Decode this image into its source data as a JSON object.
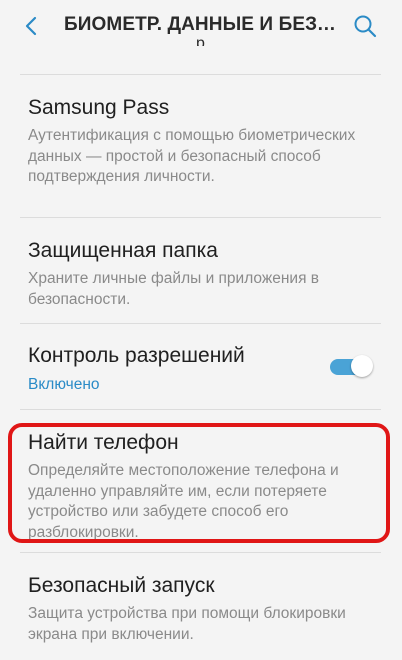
{
  "header": {
    "title": "БИОМЕТР. ДАННЫЕ И БЕЗОПАСНОСТЬ",
    "partial_item_text": "р"
  },
  "items": [
    {
      "title": "Samsung Pass",
      "description": "Аутентификация с помощью биометрических данных — простой и безопасный способ подтверждения личности."
    },
    {
      "title": "Защищенная папка",
      "description": "Храните личные файлы и приложения в безопасности."
    },
    {
      "title": "Контроль разрешений",
      "status": "Включено",
      "toggle_on": true
    },
    {
      "title": "Найти телефон",
      "description": "Определяйте местоположение телефона и удаленно управляйте им, если потеряете устройство или забудете способ его разблокировки.",
      "highlighted": true
    },
    {
      "title": "Безопасный запуск",
      "description": "Защита устройства при помощи блокировки экрана при включении."
    }
  ],
  "colors": {
    "background": "#f4f4f4",
    "accent": "#2a8bc7",
    "toggle_track": "#4aa3d6",
    "highlight": "#e01616"
  },
  "icons": {
    "back": "chevron-left-icon",
    "search": "search-icon"
  }
}
